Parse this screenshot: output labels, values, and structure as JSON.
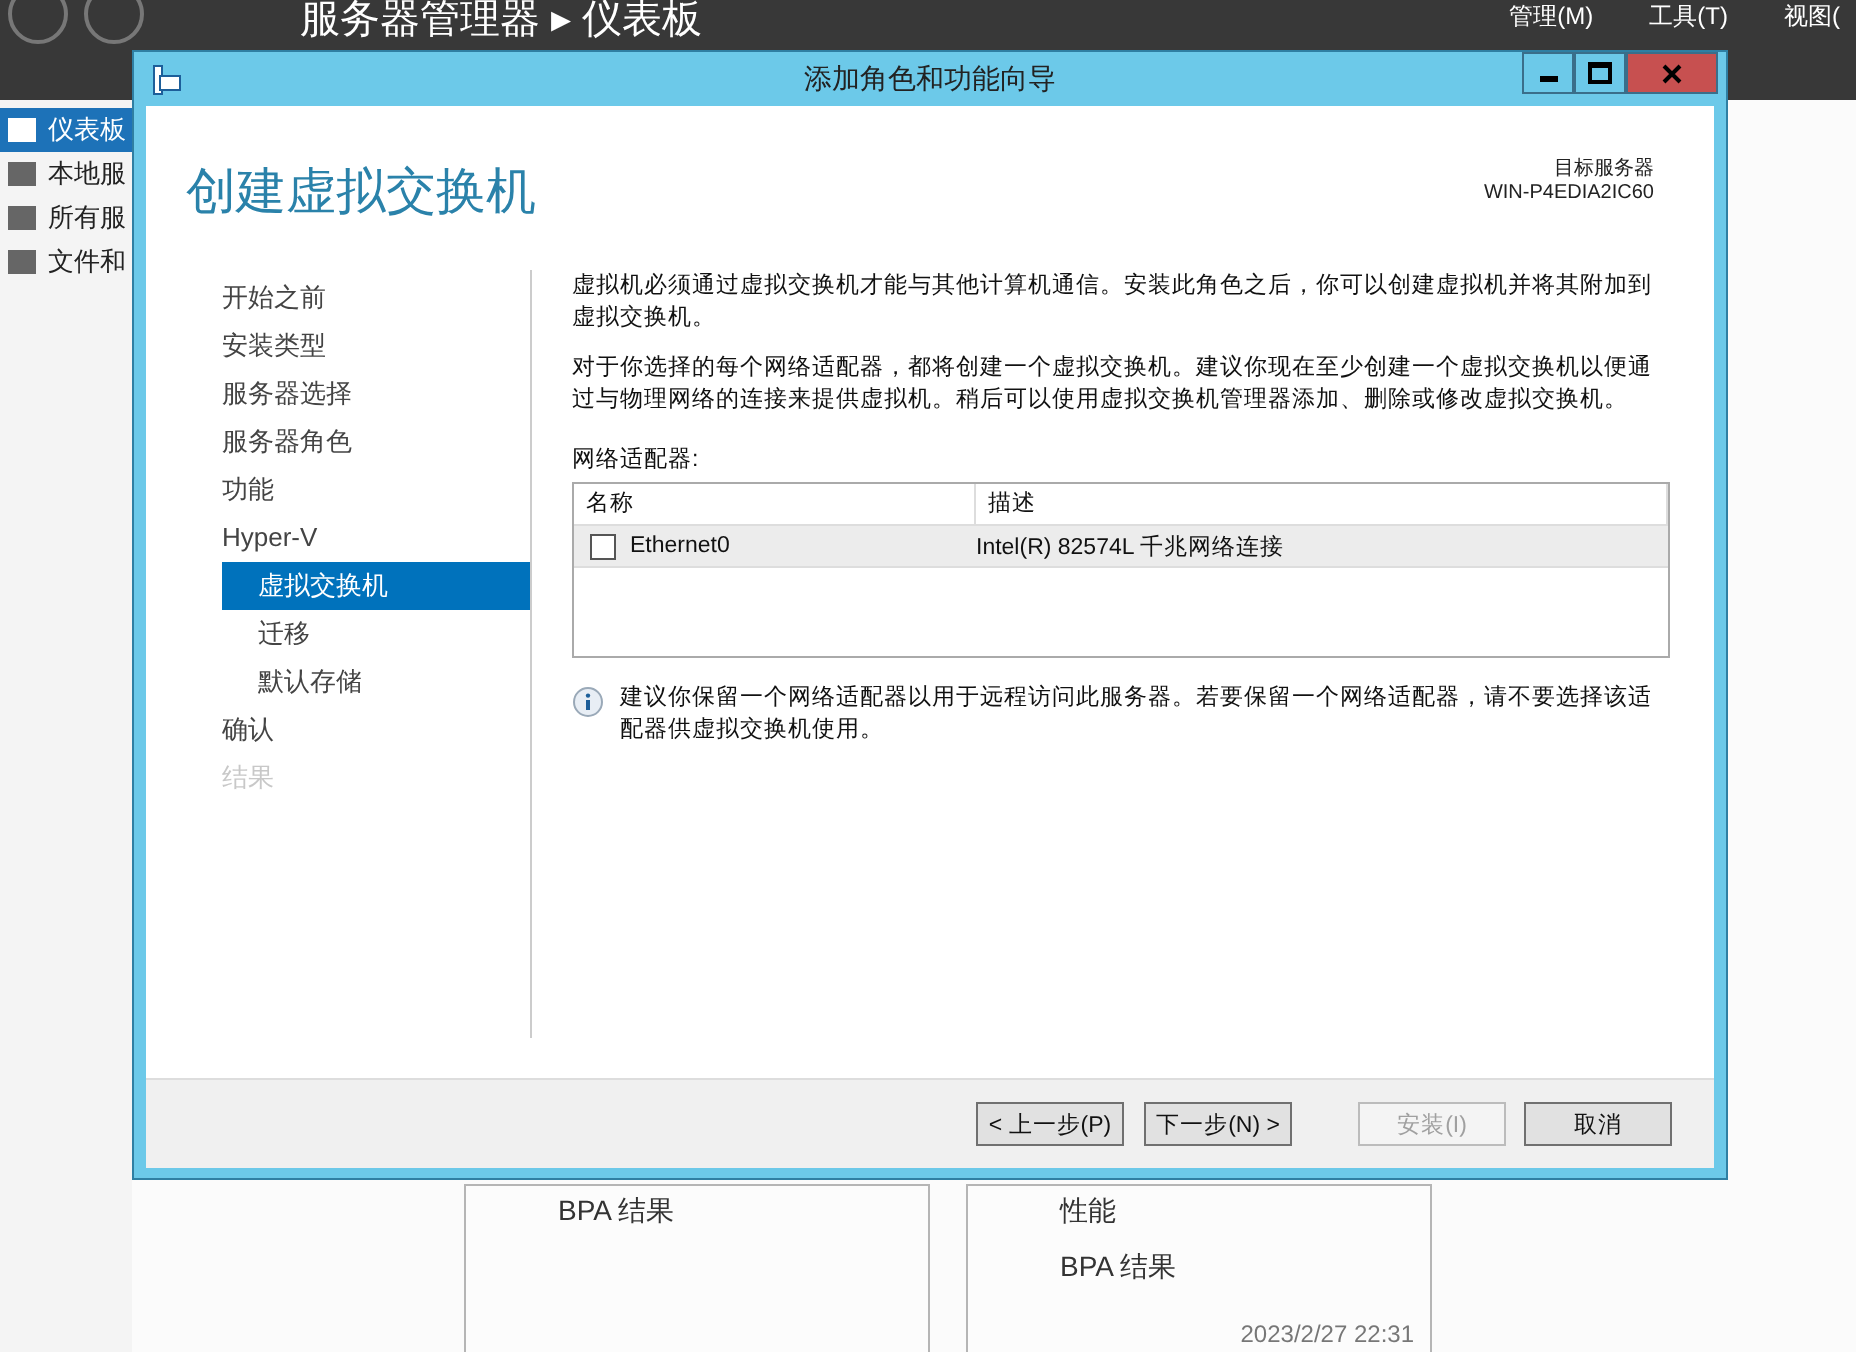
{
  "background": {
    "breadcrumb": "服务器管理器 ▸ 仪表板",
    "menu": [
      "管理(M)",
      "工具(T)",
      "视图("
    ],
    "sidebar": [
      {
        "label": "仪表板",
        "selected": true
      },
      {
        "label": "本地服",
        "selected": false
      },
      {
        "label": "所有服",
        "selected": false
      },
      {
        "label": "文件和",
        "selected": false
      }
    ],
    "tiles": [
      {
        "lines": [
          "BPA 结果"
        ]
      },
      {
        "lines": [
          "性能",
          "BPA 结果"
        ],
        "timestamp": "2023/2/27 22:31"
      }
    ]
  },
  "dialog": {
    "title": "添加角色和功能向导",
    "heading": "创建虚拟交换机",
    "target_label": "目标服务器",
    "target_server": "WIN-P4EDIA2IC60",
    "steps": [
      {
        "label": "开始之前",
        "kind": "step",
        "selected": false,
        "disabled": false
      },
      {
        "label": "安装类型",
        "kind": "step",
        "selected": false,
        "disabled": false
      },
      {
        "label": "服务器选择",
        "kind": "step",
        "selected": false,
        "disabled": false
      },
      {
        "label": "服务器角色",
        "kind": "step",
        "selected": false,
        "disabled": false
      },
      {
        "label": "功能",
        "kind": "step",
        "selected": false,
        "disabled": false
      },
      {
        "label": "Hyper-V",
        "kind": "step",
        "selected": false,
        "disabled": false
      },
      {
        "label": "虚拟交换机",
        "kind": "sub",
        "selected": true,
        "disabled": false
      },
      {
        "label": "迁移",
        "kind": "sub",
        "selected": false,
        "disabled": false
      },
      {
        "label": "默认存储",
        "kind": "sub",
        "selected": false,
        "disabled": false
      },
      {
        "label": "确认",
        "kind": "step",
        "selected": false,
        "disabled": false
      },
      {
        "label": "结果",
        "kind": "step",
        "selected": false,
        "disabled": true
      }
    ],
    "paragraphs": [
      "虚拟机必须通过虚拟交换机才能与其他计算机通信。安装此角色之后，你可以创建虚拟机并将其附加到虚拟交换机。",
      "对于你选择的每个网络适配器，都将创建一个虚拟交换机。建议你现在至少创建一个虚拟交换机以便通过与物理网络的连接来提供虚拟机。稍后可以使用虚拟交换机管理器添加、删除或修改虚拟交换机。"
    ],
    "table_label": "网络适配器:",
    "table": {
      "columns": [
        "名称",
        "描述"
      ],
      "rows": [
        {
          "name": "Ethernet0",
          "description": "Intel(R) 82574L 千兆网络连接",
          "checked": false
        }
      ]
    },
    "info": "建议你保留一个网络适配器以用于远程访问此服务器。若要保留一个网络适配器，请不要选择该适配器供虚拟交换机使用。",
    "buttons": [
      {
        "label": "< 上一步(P)",
        "disabled": false
      },
      {
        "label": "下一步(N) >",
        "disabled": false
      },
      {
        "label": "安装(I)",
        "disabled": true
      },
      {
        "label": "取消",
        "disabled": false
      }
    ]
  }
}
